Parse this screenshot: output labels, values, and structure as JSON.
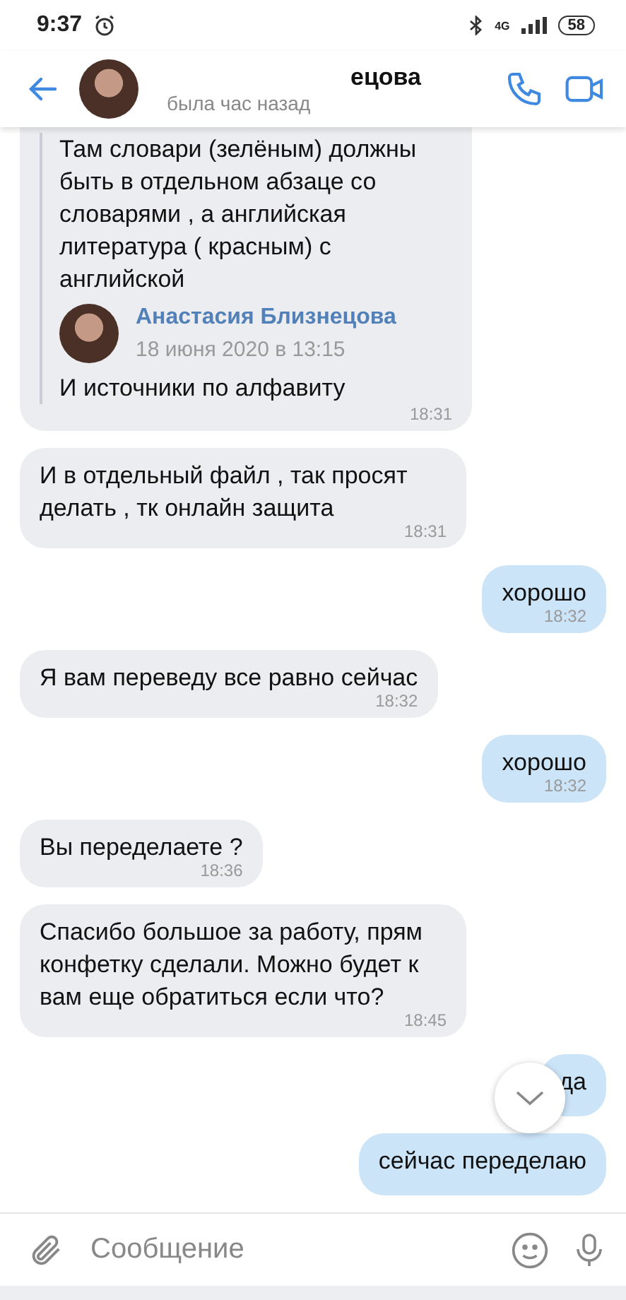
{
  "status_bar": {
    "time": "9:37",
    "network": "4G",
    "battery": "58"
  },
  "header": {
    "name": "ецова",
    "status": "была час назад"
  },
  "messages": [
    {
      "kind": "forwarded",
      "time": "18:31",
      "quotes": [
        {
          "text": "Там словари (зелёным) должны быть в отдельном абзаце со словарями , а английская литература ( красным) с английской"
        },
        {
          "author": "Анастасия Близнецова",
          "date": "18 июня 2020 в 13:15",
          "text": "И источники по алфавиту"
        }
      ]
    },
    {
      "kind": "incoming",
      "text": "И в отдельный файл , так просят делать , тк онлайн защита",
      "time": "18:31"
    },
    {
      "kind": "outgoing",
      "text": "хорошо",
      "time": "18:32"
    },
    {
      "kind": "incoming",
      "text": "Я вам переведу все равно сейчас",
      "time": "18:32"
    },
    {
      "kind": "outgoing",
      "text": "хорошо",
      "time": "18:32"
    },
    {
      "kind": "incoming",
      "text": "Вы переделаете ?",
      "time": "18:36"
    },
    {
      "kind": "incoming",
      "text": "Спасибо большое за работу, прям конфетку сделали. Можно будет к вам еще обратиться если что?",
      "time": "18:45"
    },
    {
      "kind": "outgoing",
      "text": "да"
    },
    {
      "kind": "outgoing",
      "text": "сейчас переделаю"
    }
  ],
  "composer": {
    "placeholder": "Сообщение"
  }
}
